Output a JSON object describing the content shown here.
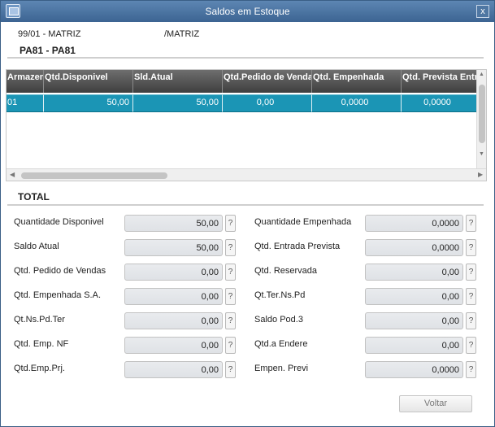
{
  "window": {
    "title": "Saldos em Estoque",
    "close_glyph": "x"
  },
  "header": {
    "branch_code": "99/01 - MATRIZ",
    "branch_name": "/MATRIZ",
    "product": "PA81 - PA81"
  },
  "grid": {
    "columns": [
      "Armazem",
      "Qtd.Disponivel",
      "Sld.Atual",
      "Qtd.Pedido de Vendas",
      "Qtd. Empenhada",
      "Qtd. Prevista Entrada"
    ],
    "rows": [
      [
        "01",
        "50,00",
        "50,00",
        "0,00",
        "0,0000",
        "0,0000"
      ]
    ]
  },
  "total": {
    "heading": "TOTAL",
    "left": [
      {
        "label": "Quantidade Disponivel",
        "value": "50,00"
      },
      {
        "label": "Saldo Atual",
        "value": "50,00"
      },
      {
        "label": "Qtd. Pedido de Vendas",
        "value": "0,00"
      },
      {
        "label": "Qtd. Empenhada S.A.",
        "value": "0,00"
      },
      {
        "label": "Qt.Ns.Pd.Ter",
        "value": "0,00"
      },
      {
        "label": "Qtd. Emp. NF",
        "value": "0,00"
      },
      {
        "label": "Qtd.Emp.Prj.",
        "value": "0,00"
      }
    ],
    "right": [
      {
        "label": "Quantidade Empenhada",
        "value": "0,0000"
      },
      {
        "label": "Qtd. Entrada Prevista",
        "value": "0,0000"
      },
      {
        "label": "Qtd. Reservada",
        "value": "0,00"
      },
      {
        "label": "Qt.Ter.Ns.Pd",
        "value": "0,00"
      },
      {
        "label": "Saldo Pod.3",
        "value": "0,00"
      },
      {
        "label": "Qtd.a Endere",
        "value": "0,00"
      },
      {
        "label": "Empen. Previ",
        "value": "0,0000"
      }
    ],
    "help_glyph": "?"
  },
  "footer": {
    "close_button": "Voltar"
  },
  "icons": {
    "app": "window-app-icon",
    "close": "close-icon",
    "help": "help-icon"
  },
  "colors": {
    "titlebar": "#4a72a0",
    "grid_header": "#555555",
    "grid_selected_row": "#1b95b5"
  }
}
